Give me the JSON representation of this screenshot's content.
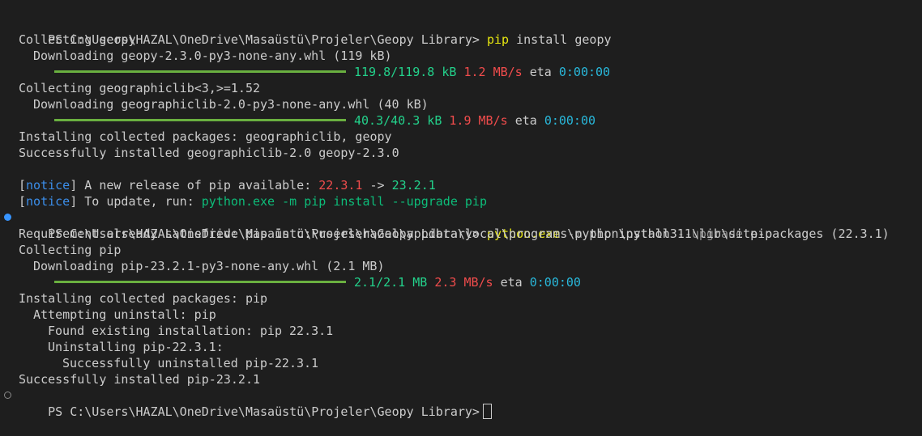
{
  "terminal": {
    "prompt": "PS C:\\Users\\HAZAL\\OneDrive\\Masaüstü\\Projeler\\Geopy Library>",
    "cmd1": {
      "program": "pip",
      "args": "install geopy"
    },
    "out": {
      "collecting_geopy": "Collecting geopy",
      "downloading_geopy": "Downloading geopy-2.3.0-py3-none-any.whl (119 kB)",
      "progress1": {
        "size": "119.8/119.8 kB",
        "speed": "1.2 MB/s",
        "eta_label": "eta",
        "eta": "0:00:00"
      },
      "collecting_geographiclib": "Collecting geographiclib<3,>=1.52",
      "downloading_geographiclib": "Downloading geographiclib-2.0-py3-none-any.whl (40 kB)",
      "progress2": {
        "size": "40.3/40.3 kB",
        "speed": "1.9 MB/s",
        "eta_label": "eta",
        "eta": "0:00:00"
      },
      "installing1": "Installing collected packages: geographiclib, geopy",
      "success1": "Successfully installed geographiclib-2.0 geopy-2.3.0"
    },
    "notice1": {
      "tag": "notice",
      "text": " A new release of pip available: ",
      "old_ver": "22.3.1",
      "arrow": " -> ",
      "new_ver": "23.2.1"
    },
    "notice2": {
      "tag": "notice",
      "text": " To update, run: ",
      "command": "python.exe -m pip install --upgrade pip"
    },
    "cmd2": {
      "program": "python.exe",
      "flag1": "-m",
      "mid": "pip install",
      "flag2": "--upgrade",
      "end": "pip"
    },
    "out2": {
      "requirement": "Requirement already satisfied: pip in c:\\users\\hazal\\appdata\\local\\programs\\python\\python311\\lib\\site-packages (22.3.1)",
      "collecting_pip": "Collecting pip",
      "downloading_pip": "Downloading pip-23.2.1-py3-none-any.whl (2.1 MB)",
      "progress3": {
        "size": "2.1/2.1 MB",
        "speed": "2.3 MB/s",
        "eta_label": "eta",
        "eta": "0:00:00"
      },
      "installing2": "Installing collected packages: pip",
      "attempting": "Attempting uninstall: pip",
      "found": "Found existing installation: pip 22.3.1",
      "uninstalling": "Uninstalling pip-22.3.1:",
      "uninstalled": "Successfully uninstalled pip-22.3.1",
      "success2": "Successfully installed pip-23.2.1"
    }
  }
}
